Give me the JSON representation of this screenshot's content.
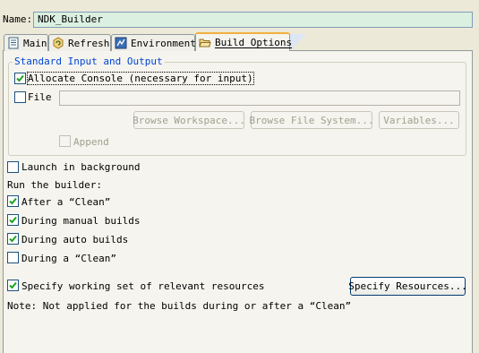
{
  "name_field": {
    "label": "Name:",
    "value": "NDK_Builder"
  },
  "tabs": [
    {
      "label": "Main",
      "icon": "document-icon"
    },
    {
      "label": "Refresh",
      "icon": "refresh-icon"
    },
    {
      "label": "Environment",
      "icon": "environment-icon"
    },
    {
      "label": "Build Options",
      "icon": "folder-open-icon",
      "active": true
    }
  ],
  "standard_io": {
    "title": "Standard Input and Output",
    "allocate_console": {
      "label": "Allocate Console (necessary for input)",
      "checked": true
    },
    "file": {
      "label": "File",
      "checked": false,
      "value": ""
    },
    "browse_workspace": "Browse Workspace...",
    "browse_file_system": "Browse File System...",
    "variables": "Variables...",
    "append": {
      "label": "Append",
      "checked": false
    }
  },
  "launch_background": {
    "label": "Launch in background",
    "checked": false
  },
  "run_builder": {
    "heading": "Run the builder:",
    "after_clean": {
      "label": "After a “Clean”",
      "checked": true
    },
    "manual_builds": {
      "label": "During manual builds",
      "checked": true
    },
    "auto_builds": {
      "label": "During auto builds",
      "checked": true
    },
    "during_clean": {
      "label": "During a “Clean”",
      "checked": false
    }
  },
  "working_set": {
    "label": "Specify working set of relevant resources",
    "checked": true,
    "button": "Specify Resources..."
  },
  "note": "Note: Not applied for the builds during or after a “Clean”",
  "colors": {
    "background": "#ece9d8",
    "name_field_bg": "#dbf0e0",
    "group_title": "#0046d5",
    "active_tab_accent": "#f0b040"
  }
}
